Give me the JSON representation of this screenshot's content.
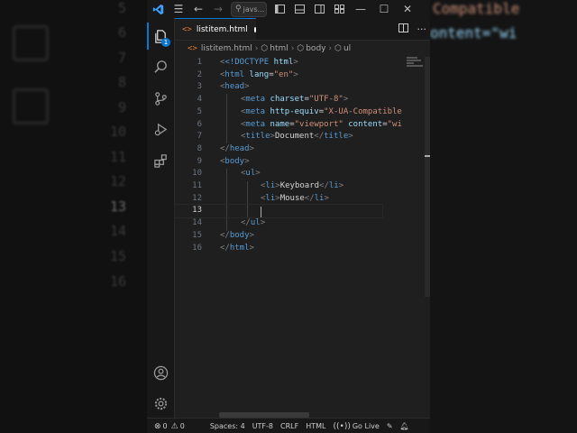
{
  "window": {
    "search_text": "javs...",
    "tab": {
      "filename": "listitem.html",
      "icon": "<>"
    },
    "breadcrumb": [
      "listitem.html",
      "html",
      "body",
      "ul"
    ]
  },
  "activity_bar": {
    "explorer_badge": "1"
  },
  "editor": {
    "current_line": 13,
    "lines": [
      {
        "n": "1"
      },
      {
        "n": "2"
      },
      {
        "n": "3"
      },
      {
        "n": "4"
      },
      {
        "n": "5"
      },
      {
        "n": "6"
      },
      {
        "n": "7"
      },
      {
        "n": "8"
      },
      {
        "n": "9"
      },
      {
        "n": "10"
      },
      {
        "n": "11"
      },
      {
        "n": "12"
      },
      {
        "n": "13"
      },
      {
        "n": "14"
      },
      {
        "n": "15"
      },
      {
        "n": "16"
      }
    ],
    "tokens": {
      "doctype": "<!DOCTYPE",
      "doctype_html": "html",
      "html": "html",
      "head": "head",
      "meta": "meta",
      "charset": "charset",
      "charset_val": "\"UTF-8\"",
      "http_equiv": "http-equiv",
      "http_equiv_val": "\"X-UA-Compatible",
      "name": "name",
      "name_val": "\"viewport\"",
      "content": "content",
      "content_val": "\"wi",
      "lang": "lang",
      "lang_val": "\"en\"",
      "title": "title",
      "title_text": "Document",
      "body": "body",
      "ul": "ul",
      "li": "li",
      "li1": "Keyboard",
      "li2": "Mouse"
    }
  },
  "status_bar": {
    "errors": "0",
    "warnings": "0",
    "spaces": "Spaces: 4",
    "encoding": "UTF-8",
    "eol": "CRLF",
    "language": "HTML",
    "go_live": "Go Live"
  },
  "background": {
    "line_numbers": [
      "5",
      "6",
      "7",
      "8",
      "9",
      "10",
      "11",
      "12",
      "13",
      "14",
      "15",
      "16"
    ],
    "code_fragments": [
      "Compatible",
      "ontent=\"wi"
    ]
  },
  "colors": {
    "accent": "#0078d4",
    "editor_bg": "#1f1f1f",
    "sidebar_bg": "#181818",
    "tag": "#569cd6",
    "attr": "#9cdcfe",
    "string": "#ce9178",
    "bracket": "#808080"
  }
}
